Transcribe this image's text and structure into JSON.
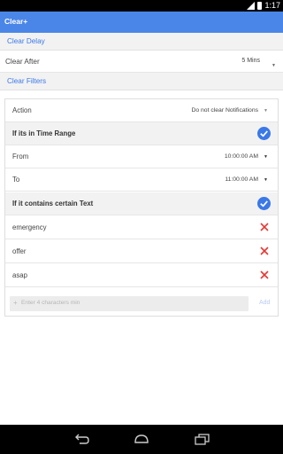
{
  "status_bar": {
    "time": "1:17"
  },
  "app_bar": {
    "title": "Clear+"
  },
  "clear_delay": {
    "header": "Clear Delay",
    "label": "Clear After",
    "value": "5 Mins"
  },
  "clear_filters": {
    "header": "Clear Filters",
    "action_label": "Action",
    "action_value": "Do not clear Notifications",
    "time_range": {
      "header": "If its in Time Range",
      "from_label": "From",
      "from_value": "10:00:00 AM",
      "to_label": "To",
      "to_value": "11:00:00 AM"
    },
    "text_filter": {
      "header": "If it contains certain Text",
      "items": [
        "emergency",
        "offer",
        "asap"
      ],
      "placeholder": "Enter 4 characters min",
      "add_label": "Add"
    }
  },
  "colors": {
    "accent": "#4a86e8",
    "delete": "#e53935"
  },
  "icons": {
    "checked": "check-circle-icon",
    "delete": "close-icon",
    "add": "plus-icon"
  }
}
